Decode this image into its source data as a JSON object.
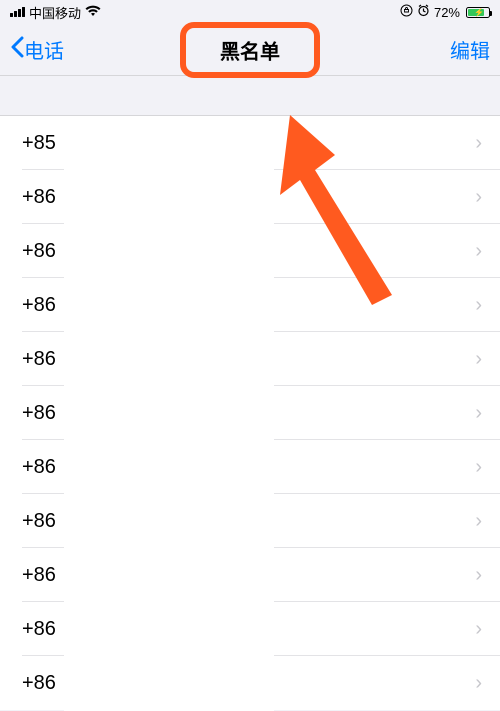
{
  "status": {
    "carrier": "中国移动",
    "battery_pct": "72%"
  },
  "nav": {
    "back_label": "电话",
    "title": "黑名单",
    "edit_label": "编辑"
  },
  "list": {
    "items": [
      {
        "label": "+85"
      },
      {
        "label": "+86"
      },
      {
        "label": "+86"
      },
      {
        "label": "+86"
      },
      {
        "label": "+86"
      },
      {
        "label": "+86"
      },
      {
        "label": "+86"
      },
      {
        "label": "+86"
      },
      {
        "label": "+86"
      },
      {
        "label": "+86"
      },
      {
        "label": "+86"
      }
    ]
  }
}
